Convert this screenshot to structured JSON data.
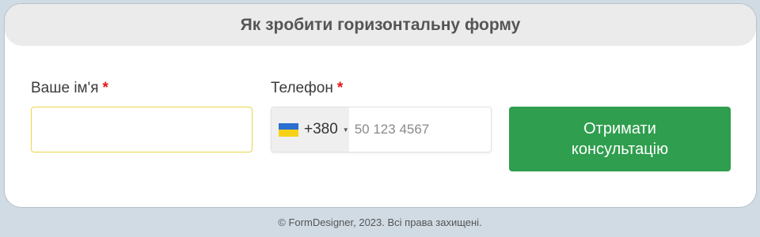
{
  "form": {
    "title": "Як зробити горизонтальну форму",
    "name_field": {
      "label": "Ваше ім'я",
      "required_mark": "*",
      "value": "",
      "placeholder": ""
    },
    "phone_field": {
      "label": "Телефон",
      "required_mark": "*",
      "country_flag": "ukraine-flag-icon",
      "dial_code": "+380",
      "value": "",
      "placeholder": "50 123 4567"
    },
    "submit": {
      "line1": "Отримати",
      "line2": "консультацію"
    }
  },
  "footer": {
    "text": "© FormDesigner, 2023. Всі права захищені."
  },
  "colors": {
    "page_bg": "#d0dbe4",
    "card_bg": "#ffffff",
    "header_bg": "#ebebeb",
    "required": "#e31616",
    "button": "#2f9e4e",
    "name_input_border": "#ead54a"
  }
}
